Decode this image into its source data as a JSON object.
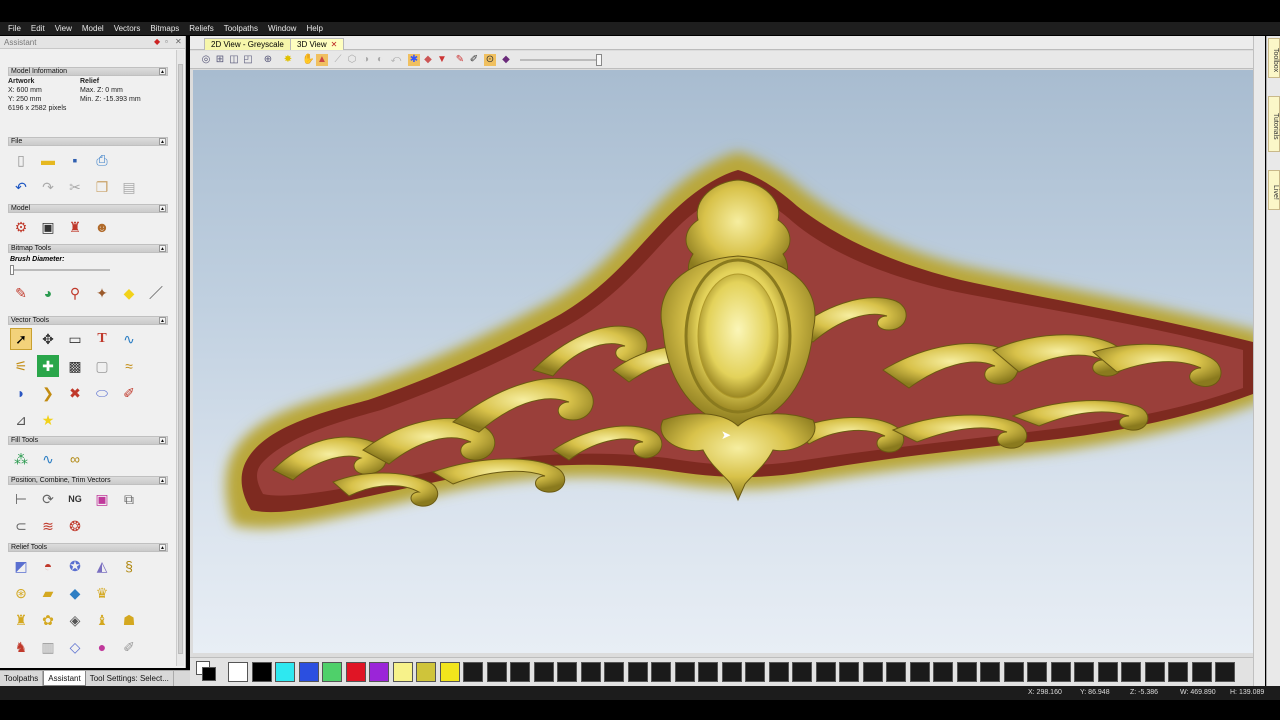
{
  "menu": [
    "File",
    "Edit",
    "View",
    "Model",
    "Vectors",
    "Bitmaps",
    "Reliefs",
    "Toolpaths",
    "Window",
    "Help"
  ],
  "assistant": {
    "title": "Assistant",
    "model_info": {
      "header": "Model Information",
      "artwork_label": "Artwork",
      "x": "X: 600 mm",
      "y": "Y: 250 mm",
      "pixels": "6196 x 2582 pixels",
      "relief_label": "Relief",
      "max_z": "Max. Z: 0 mm",
      "min_z": "Min. Z: -15.393 mm"
    },
    "sections": {
      "file": "File",
      "model": "Model",
      "bitmap_tools": "Bitmap Tools",
      "brush_diameter": "Brush Diameter:",
      "vector_tools": "Vector Tools",
      "fill_tools": "Fill Tools",
      "position_combine": "Position, Combine, Trim Vectors",
      "relief_tools": "Relief Tools"
    }
  },
  "bottom_tabs": [
    "Toolpaths",
    "Assistant",
    "Tool Settings: Select..."
  ],
  "view_tabs": [
    "2D View - Greyscale",
    "3D View"
  ],
  "right_tabs": [
    "Toolbox",
    "Tutorials",
    "Live!"
  ],
  "palette": {
    "colors": [
      "#ffffff",
      "#000000",
      "#2ee8f0",
      "#2b4fe0",
      "#4fd06a",
      "#e01525",
      "#9b25d8",
      "#f7f28a",
      "#cfc43a",
      "#f2e51c"
    ],
    "empty_count": 33
  },
  "status": {
    "x": "X: 298.160",
    "y": "Y: 86.948",
    "z": "Z: -5.386",
    "w": "W: 469.890",
    "h": "H: 139.089"
  },
  "colors": {
    "relief_gold": "#d8c24a",
    "relief_red": "#8c2b22",
    "background_top": "#a8bcd0",
    "background_bottom": "#e8eef5"
  }
}
